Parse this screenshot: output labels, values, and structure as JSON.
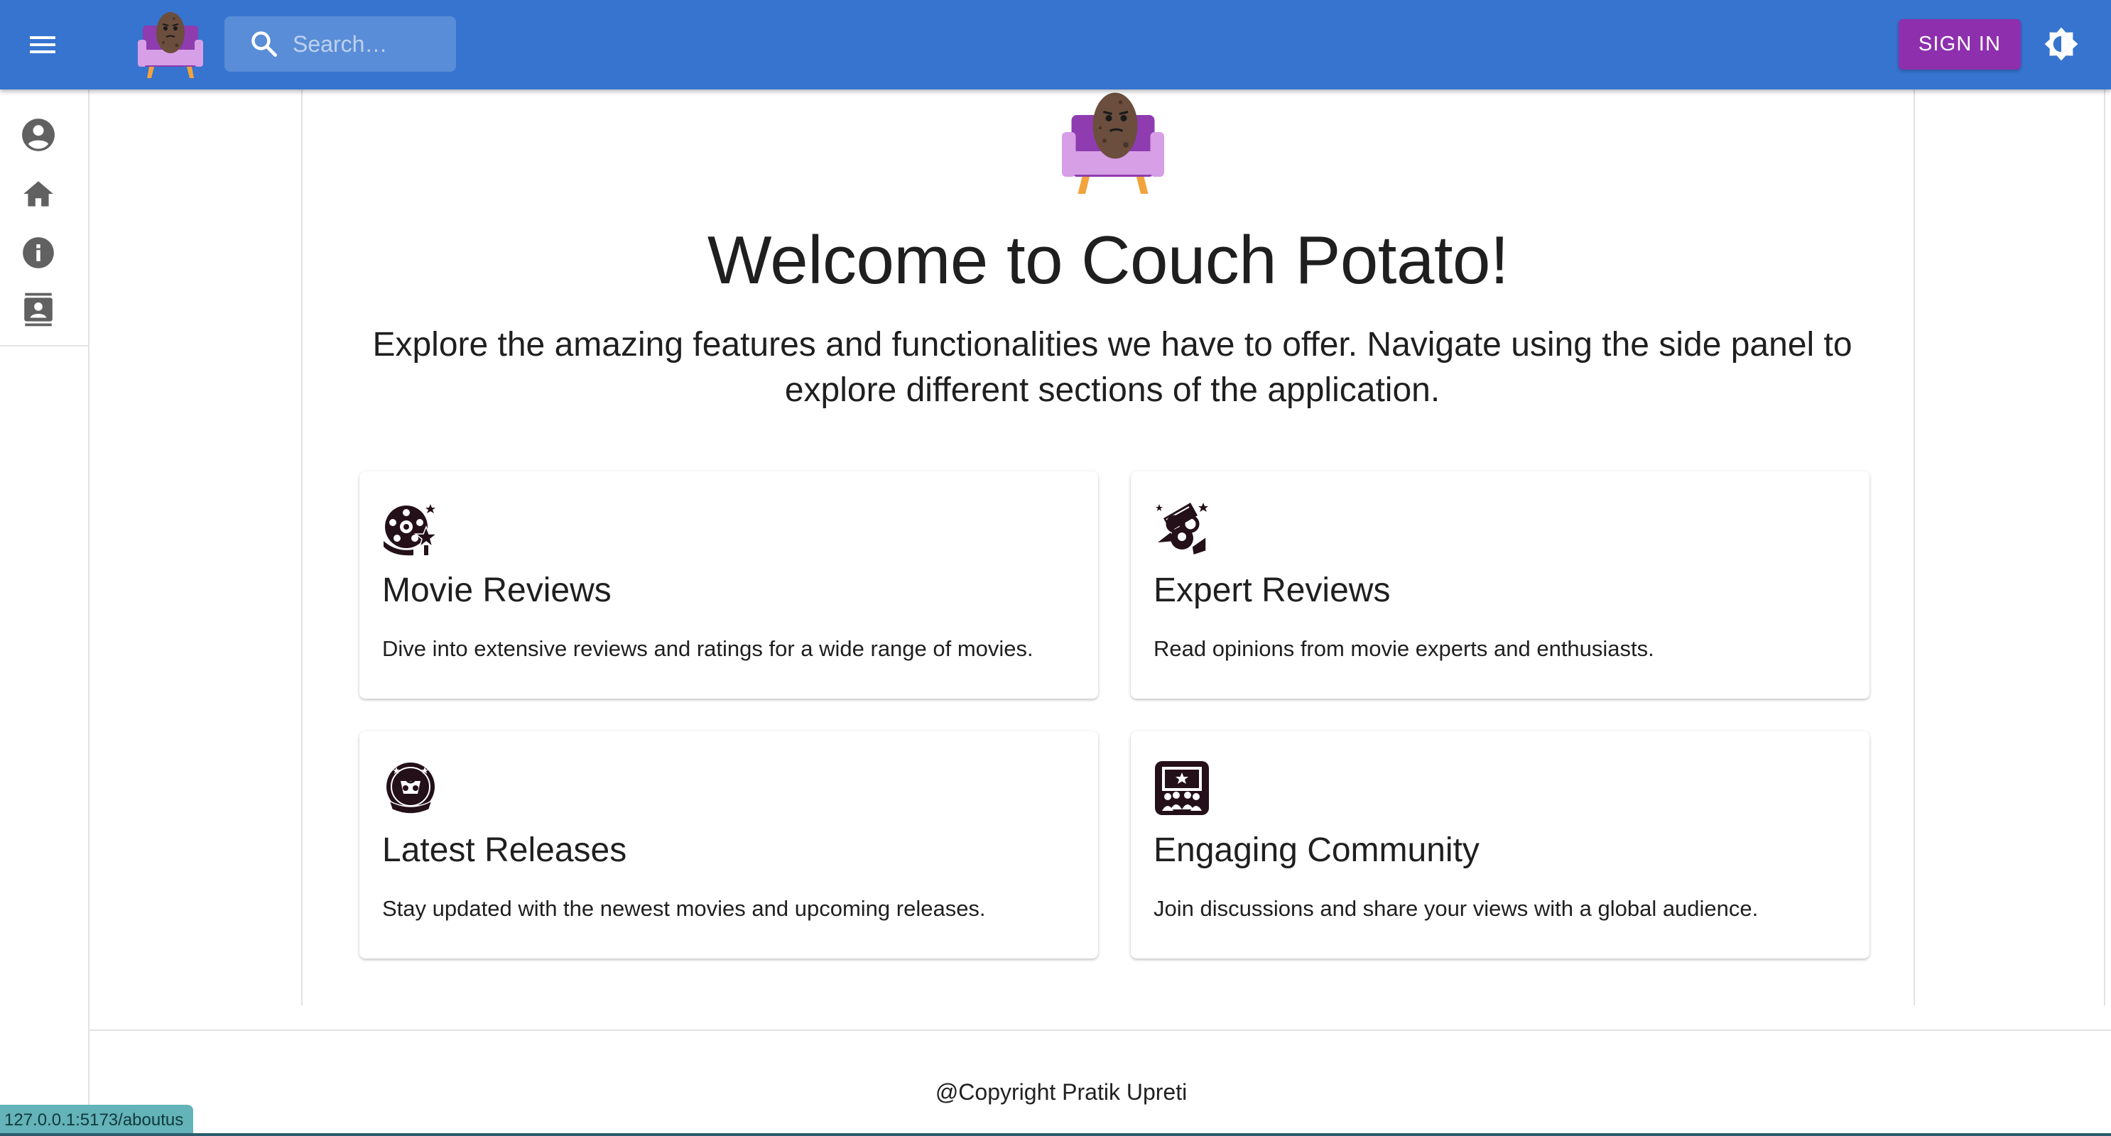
{
  "colors": {
    "appbar": "#3674cf",
    "signin_button": "#8e2fae",
    "logo_purple": "#8e3cb0",
    "logo_cushion": "#d69fe6",
    "logo_legs": "#f3a33b",
    "potato": "#6b4e3d",
    "status_bar": "#63b3b8"
  },
  "header": {
    "menu_icon": "hamburger-menu-icon",
    "logo_icon": "couch-potato-logo",
    "search": {
      "icon": "search-icon",
      "placeholder": "Search…",
      "value": ""
    },
    "signin_label": "SIGN IN",
    "theme_toggle_icon": "brightness-icon"
  },
  "sidebar": {
    "items": [
      {
        "name": "account",
        "icon": "account-circle-icon"
      },
      {
        "name": "home",
        "icon": "home-icon"
      },
      {
        "name": "about",
        "icon": "info-icon"
      },
      {
        "name": "contact",
        "icon": "contact-card-icon"
      }
    ]
  },
  "main": {
    "logo_icon": "couch-potato-logo",
    "title": "Welcome to Couch Potato!",
    "subtitle": "Explore the amazing features and functionalities we have to offer. Navigate using the side panel to explore different sections of the application.",
    "features": [
      {
        "icon": "film-reel-star-icon",
        "title": "Movie Reviews",
        "description": "Dive into extensive reviews and ratings for a wide range of movies."
      },
      {
        "icon": "expert-glasses-icon",
        "title": "Expert Reviews",
        "description": "Read opinions from movie experts and enthusiasts."
      },
      {
        "icon": "premiere-badge-icon",
        "title": "Latest Releases",
        "description": "Stay updated with the newest movies and upcoming releases."
      },
      {
        "icon": "audience-screen-icon",
        "title": "Engaging Community",
        "description": "Join discussions and share your views with a global audience."
      }
    ]
  },
  "footer": {
    "text": "@Copyright Pratik Upreti"
  },
  "status_bar": {
    "url": "127.0.0.1:5173/aboutus"
  }
}
